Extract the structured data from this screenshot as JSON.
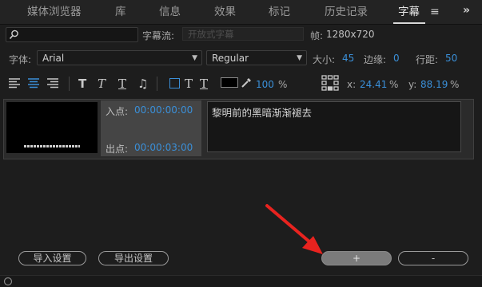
{
  "tabs": [
    {
      "label": "媒体浏览器"
    },
    {
      "label": "库"
    },
    {
      "label": "信息"
    },
    {
      "label": "效果"
    },
    {
      "label": "标记"
    },
    {
      "label": "历史记录"
    },
    {
      "label": "字幕"
    }
  ],
  "toolbar1": {
    "stream_label": "字幕流:",
    "stream_value": "开放式字幕",
    "frame_label": "帧:",
    "frame_value": "1280x720"
  },
  "toolbar2": {
    "font_label": "字体:",
    "font_value": "Arial",
    "style_value": "Regular",
    "size_label": "大小:",
    "size_value": "45",
    "edge_label": "边缘:",
    "edge_value": "0",
    "spacing_label": "行距:",
    "spacing_value": "50"
  },
  "toolbar3": {
    "opacity_value": "100",
    "percent": "%",
    "x_label": "x:",
    "x_value": "24.41",
    "y_label": "y:",
    "y_value": "88.19"
  },
  "clip": {
    "in_label": "入点:",
    "in_value": "00:00:00:00",
    "out_label": "出点:",
    "out_value": "00:00:03:00",
    "text": "黎明前的黑暗渐渐褪去"
  },
  "buttons": {
    "import": "导入设置",
    "export": "导出设置",
    "add": "+",
    "remove": "-"
  },
  "colors": {
    "accent": "#3b8fd8",
    "arrow": "#e8231f"
  }
}
